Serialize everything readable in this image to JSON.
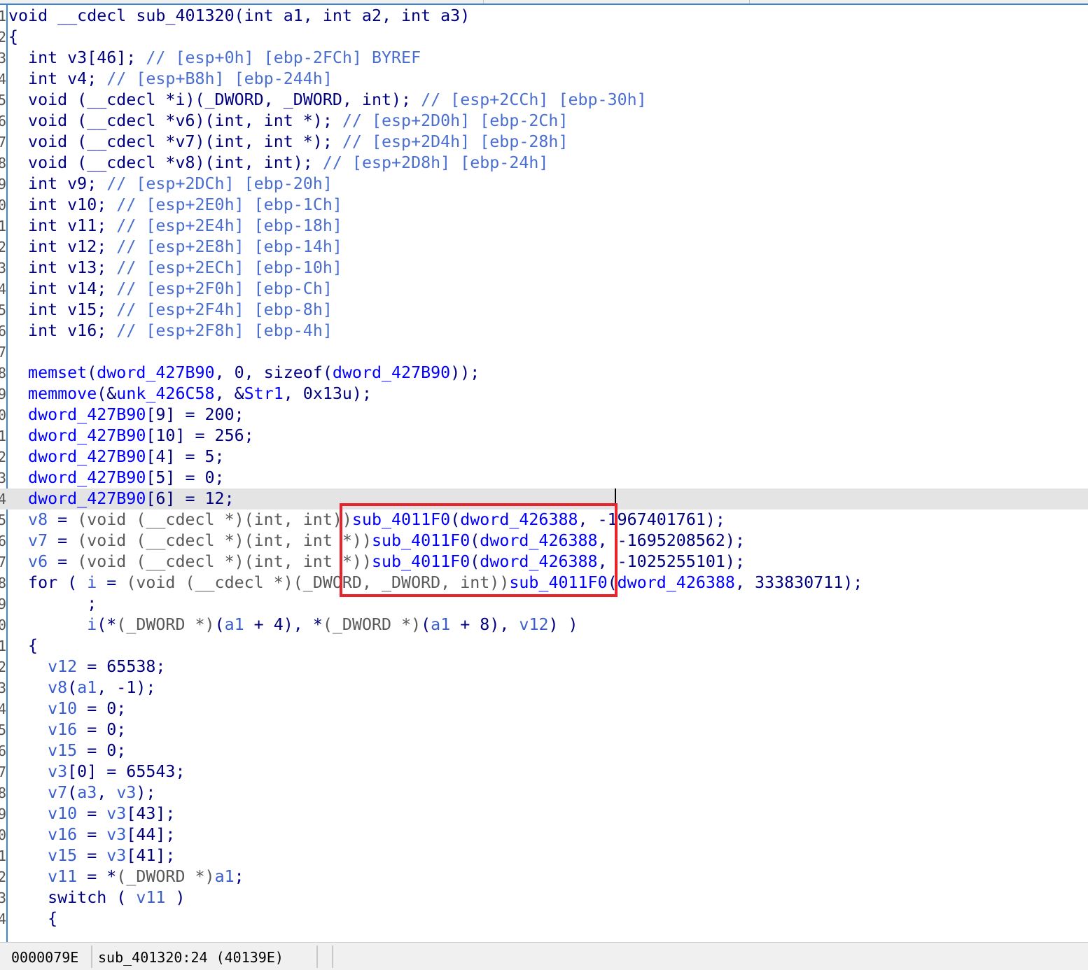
{
  "pseudocode": {
    "line_number_prefixes": [
      "1",
      "2",
      "3",
      "4",
      "5",
      "6",
      "7",
      "8",
      "9",
      "0",
      "1",
      "2",
      "3",
      "4",
      "5",
      "6",
      "7",
      "8",
      "9",
      "0",
      "1",
      "2",
      "3",
      "4",
      "5",
      "6",
      "7",
      "8",
      "9",
      "0",
      "1",
      "2",
      "3",
      "4",
      "5",
      "6",
      "7",
      "8",
      "9",
      "0",
      "1",
      "2",
      "3",
      "4"
    ],
    "highlighted_line_index": 23,
    "lines": [
      [
        [
          "k",
          "void __cdecl sub_401320(int a1, int a2, int a3)"
        ]
      ],
      [
        [
          "k",
          "{"
        ]
      ],
      [
        [
          "k",
          "  int v3[46]; "
        ],
        [
          "c",
          "// [esp+0h] [ebp-2FCh] BYREF"
        ]
      ],
      [
        [
          "k",
          "  int v4; "
        ],
        [
          "c",
          "// [esp+B8h] [ebp-244h]"
        ]
      ],
      [
        [
          "k",
          "  void (__cdecl *i)(_DWORD, _DWORD, int); "
        ],
        [
          "c",
          "// [esp+2CCh] [ebp-30h]"
        ]
      ],
      [
        [
          "k",
          "  void (__cdecl *v6)(int, int *); "
        ],
        [
          "c",
          "// [esp+2D0h] [ebp-2Ch]"
        ]
      ],
      [
        [
          "k",
          "  void (__cdecl *v7)(int, int *); "
        ],
        [
          "c",
          "// [esp+2D4h] [ebp-28h]"
        ]
      ],
      [
        [
          "k",
          "  void (__cdecl *v8)(int, int); "
        ],
        [
          "c",
          "// [esp+2D8h] [ebp-24h]"
        ]
      ],
      [
        [
          "k",
          "  int v9; "
        ],
        [
          "c",
          "// [esp+2DCh] [ebp-20h]"
        ]
      ],
      [
        [
          "k",
          "  int v10; "
        ],
        [
          "c",
          "// [esp+2E0h] [ebp-1Ch]"
        ]
      ],
      [
        [
          "k",
          "  int v11; "
        ],
        [
          "c",
          "// [esp+2E4h] [ebp-18h]"
        ]
      ],
      [
        [
          "k",
          "  int v12; "
        ],
        [
          "c",
          "// [esp+2E8h] [ebp-14h]"
        ]
      ],
      [
        [
          "k",
          "  int v13; "
        ],
        [
          "c",
          "// [esp+2ECh] [ebp-10h]"
        ]
      ],
      [
        [
          "k",
          "  int v14; "
        ],
        [
          "c",
          "// [esp+2F0h] [ebp-Ch]"
        ]
      ],
      [
        [
          "k",
          "  int v15; "
        ],
        [
          "c",
          "// [esp+2F4h] [ebp-8h]"
        ]
      ],
      [
        [
          "k",
          "  int v16; "
        ],
        [
          "c",
          "// [esp+2F8h] [ebp-4h]"
        ]
      ],
      [
        [
          "k",
          ""
        ]
      ],
      [
        [
          "d",
          "  memset"
        ],
        [
          "p",
          "("
        ],
        [
          "d",
          "dword_427B90"
        ],
        [
          "p",
          ", 0, sizeof("
        ],
        [
          "d",
          "dword_427B90"
        ],
        [
          "p",
          "));"
        ]
      ],
      [
        [
          "d",
          "  memmove"
        ],
        [
          "p",
          "(&"
        ],
        [
          "d",
          "unk_426C58"
        ],
        [
          "p",
          ", &"
        ],
        [
          "d",
          "Str1"
        ],
        [
          "p",
          ", 0x13u);"
        ]
      ],
      [
        [
          "d",
          "  dword_427B90"
        ],
        [
          "p",
          "[9] = 200;"
        ]
      ],
      [
        [
          "d",
          "  dword_427B90"
        ],
        [
          "p",
          "[10] = 256;"
        ]
      ],
      [
        [
          "d",
          "  dword_427B90"
        ],
        [
          "p",
          "[4] = 5;"
        ]
      ],
      [
        [
          "d",
          "  dword_427B90"
        ],
        [
          "p",
          "[5] = 0;"
        ]
      ],
      [
        [
          "d",
          "  dword_427B90"
        ],
        [
          "p",
          "[6] = 12;"
        ]
      ],
      [
        [
          "v",
          "  v8"
        ],
        [
          "p",
          " = "
        ],
        [
          "g",
          "(void (__cdecl *)(int, int))"
        ],
        [
          "d",
          "sub_4011F0"
        ],
        [
          "p",
          "("
        ],
        [
          "d",
          "dword_426388"
        ],
        [
          "p",
          ", -1967401761);"
        ]
      ],
      [
        [
          "v",
          "  v7"
        ],
        [
          "p",
          " = "
        ],
        [
          "g",
          "(void (__cdecl *)(int, int *))"
        ],
        [
          "d",
          "sub_4011F0"
        ],
        [
          "p",
          "("
        ],
        [
          "d",
          "dword_426388"
        ],
        [
          "p",
          ", -1695208562);"
        ]
      ],
      [
        [
          "v",
          "  v6"
        ],
        [
          "p",
          " = "
        ],
        [
          "g",
          "(void (__cdecl *)(int, int *))"
        ],
        [
          "d",
          "sub_4011F0"
        ],
        [
          "p",
          "("
        ],
        [
          "d",
          "dword_426388"
        ],
        [
          "p",
          ", -1025255101);"
        ]
      ],
      [
        [
          "k",
          "  for "
        ],
        [
          "p",
          "( "
        ],
        [
          "v",
          "i"
        ],
        [
          "p",
          " = "
        ],
        [
          "g",
          "(void (__cdecl *)(_DWORD, _DWORD, int))"
        ],
        [
          "d",
          "sub_4011F0"
        ],
        [
          "p",
          "("
        ],
        [
          "d",
          "dword_426388"
        ],
        [
          "p",
          ", 333830711);"
        ]
      ],
      [
        [
          "p",
          "        ;"
        ]
      ],
      [
        [
          "v",
          "        i"
        ],
        [
          "p",
          "(*"
        ],
        [
          "g",
          "(_DWORD *)"
        ],
        [
          "p",
          "("
        ],
        [
          "v",
          "a1"
        ],
        [
          "p",
          " + 4), *"
        ],
        [
          "g",
          "(_DWORD *)"
        ],
        [
          "p",
          "("
        ],
        [
          "v",
          "a1"
        ],
        [
          "p",
          " + 8), "
        ],
        [
          "v",
          "v12"
        ],
        [
          "p",
          ") )"
        ]
      ],
      [
        [
          "p",
          "  {"
        ]
      ],
      [
        [
          "v",
          "    v12"
        ],
        [
          "p",
          " = 65538;"
        ]
      ],
      [
        [
          "v",
          "    v8"
        ],
        [
          "p",
          "("
        ],
        [
          "v",
          "a1"
        ],
        [
          "p",
          ", -1);"
        ]
      ],
      [
        [
          "v",
          "    v10"
        ],
        [
          "p",
          " = 0;"
        ]
      ],
      [
        [
          "v",
          "    v16"
        ],
        [
          "p",
          " = 0;"
        ]
      ],
      [
        [
          "v",
          "    v15"
        ],
        [
          "p",
          " = 0;"
        ]
      ],
      [
        [
          "v",
          "    v3"
        ],
        [
          "p",
          "[0] = 65543;"
        ]
      ],
      [
        [
          "v",
          "    v7"
        ],
        [
          "p",
          "("
        ],
        [
          "v",
          "a3"
        ],
        [
          "p",
          ", "
        ],
        [
          "v",
          "v3"
        ],
        [
          "p",
          ");"
        ]
      ],
      [
        [
          "v",
          "    v10"
        ],
        [
          "p",
          " = "
        ],
        [
          "v",
          "v3"
        ],
        [
          "p",
          "[43];"
        ]
      ],
      [
        [
          "v",
          "    v16"
        ],
        [
          "p",
          " = "
        ],
        [
          "v",
          "v3"
        ],
        [
          "p",
          "[44];"
        ]
      ],
      [
        [
          "v",
          "    v15"
        ],
        [
          "p",
          " = "
        ],
        [
          "v",
          "v3"
        ],
        [
          "p",
          "[41];"
        ]
      ],
      [
        [
          "v",
          "    v11"
        ],
        [
          "p",
          " = *"
        ],
        [
          "g",
          "(_DWORD *)"
        ],
        [
          "v",
          "a1"
        ],
        [
          "p",
          ";"
        ]
      ],
      [
        [
          "k",
          "    switch "
        ],
        [
          "p",
          "( "
        ],
        [
          "v",
          "v11"
        ],
        [
          "p",
          " )"
        ]
      ],
      [
        [
          "p",
          "    {"
        ]
      ]
    ]
  },
  "status_bar": {
    "offset": "0000079E",
    "location": "sub_401320:24 (40139E)"
  },
  "colors": {
    "accent_border": "#3c84d4",
    "annotation_box": "#e8232c",
    "current_line": "#e4e4e4"
  }
}
